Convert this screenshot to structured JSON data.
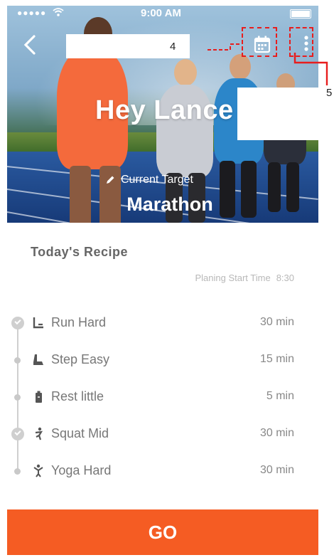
{
  "status_bar": {
    "signal": "●●●●●",
    "time": "9:00 AM"
  },
  "hero": {
    "greeting": "Hey Lance",
    "target_label": "Current Target",
    "target_value": "Marathon"
  },
  "annotations": {
    "callout_4": "4",
    "callout_5": "5"
  },
  "recipe": {
    "title": "Today's Recipe",
    "plan_label": "Planing Start Time",
    "plan_time": "8:30",
    "steps": [
      {
        "name": "Run Hard",
        "duration": "30 min",
        "icon": "run-icon",
        "done": true
      },
      {
        "name": "Step Easy",
        "duration": "15 min",
        "icon": "step-icon",
        "done": false
      },
      {
        "name": "Rest little",
        "duration": "5 min",
        "icon": "rest-icon",
        "done": false
      },
      {
        "name": "Squat Mid",
        "duration": "30 min",
        "icon": "squat-icon",
        "done": true
      },
      {
        "name": "Yoga Hard",
        "duration": "30 min",
        "icon": "yoga-icon",
        "done": false
      }
    ]
  },
  "actions": {
    "go_label": "GO"
  },
  "colors": {
    "accent": "#f55c23",
    "annotation_red": "#e81d1d",
    "muted": "#b8b8b8"
  }
}
